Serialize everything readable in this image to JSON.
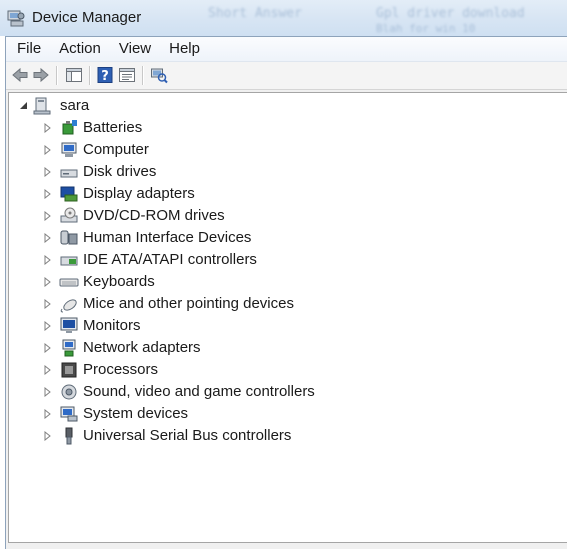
{
  "window": {
    "title": "Device Manager",
    "background_blur_text": [
      "Short Answer",
      "Gpl driver download",
      "Blah for win 10"
    ]
  },
  "menubar": {
    "items": [
      "File",
      "Action",
      "View",
      "Help"
    ]
  },
  "toolbar": {
    "buttons": [
      "back-arrow-icon",
      "forward-arrow-icon",
      "show-hide-console-tree-icon",
      "help-icon",
      "properties-icon",
      "scan-hardware-icon"
    ]
  },
  "tree": {
    "root_label": "sara",
    "items": [
      {
        "label": "Batteries",
        "icon": "battery-icon"
      },
      {
        "label": "Computer",
        "icon": "computer-icon"
      },
      {
        "label": "Disk drives",
        "icon": "disk-drive-icon"
      },
      {
        "label": "Display adapters",
        "icon": "display-adapter-icon"
      },
      {
        "label": "DVD/CD-ROM drives",
        "icon": "dvd-drive-icon"
      },
      {
        "label": "Human Interface Devices",
        "icon": "hid-icon"
      },
      {
        "label": "IDE ATA/ATAPI controllers",
        "icon": "ide-controller-icon"
      },
      {
        "label": "Keyboards",
        "icon": "keyboard-icon"
      },
      {
        "label": "Mice and other pointing devices",
        "icon": "mouse-icon"
      },
      {
        "label": "Monitors",
        "icon": "monitor-icon"
      },
      {
        "label": "Network adapters",
        "icon": "network-adapter-icon"
      },
      {
        "label": "Processors",
        "icon": "processor-icon"
      },
      {
        "label": "Sound, video and game controllers",
        "icon": "sound-icon"
      },
      {
        "label": "System devices",
        "icon": "system-devices-icon"
      },
      {
        "label": "Universal Serial Bus controllers",
        "icon": "usb-icon"
      }
    ]
  },
  "colors": {
    "titlebar": "#d6e4f3",
    "window_border": "#8ea3bb",
    "tree_background": "#ffffff"
  }
}
